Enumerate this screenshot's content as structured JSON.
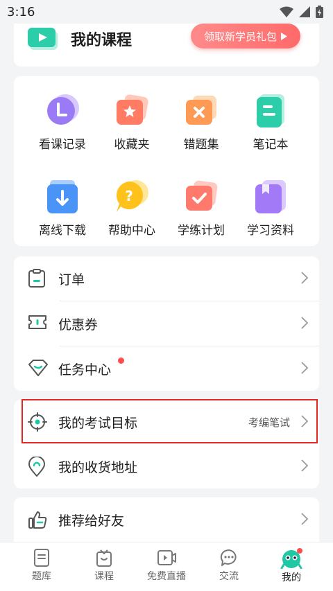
{
  "status_bar": {
    "time": "3:16"
  },
  "course": {
    "title": "我的课程",
    "gift_button": "领取新学员礼包"
  },
  "grid": [
    {
      "label": "看课记录"
    },
    {
      "label": "收藏夹"
    },
    {
      "label": "错题集"
    },
    {
      "label": "笔记本"
    },
    {
      "label": "离线下载"
    },
    {
      "label": "帮助中心"
    },
    {
      "label": "学练计划"
    },
    {
      "label": "学习资料"
    }
  ],
  "menu_group1": [
    {
      "label": "订单"
    },
    {
      "label": "优惠券"
    },
    {
      "label": "任务中心"
    }
  ],
  "menu_group2": [
    {
      "label": "我的考试目标",
      "value": "考编笔试"
    },
    {
      "label": "我的收货地址"
    }
  ],
  "menu_group3": [
    {
      "label": "推荐给好友"
    }
  ],
  "tabbar": [
    {
      "label": "题库"
    },
    {
      "label": "课程"
    },
    {
      "label": "免费直播"
    },
    {
      "label": "交流"
    },
    {
      "label": "我的"
    }
  ],
  "colors": {
    "accent": "#1fc7a4",
    "gift": "#ff6a6a",
    "badge": "#ff4d4f",
    "highlight": "#e32626"
  }
}
